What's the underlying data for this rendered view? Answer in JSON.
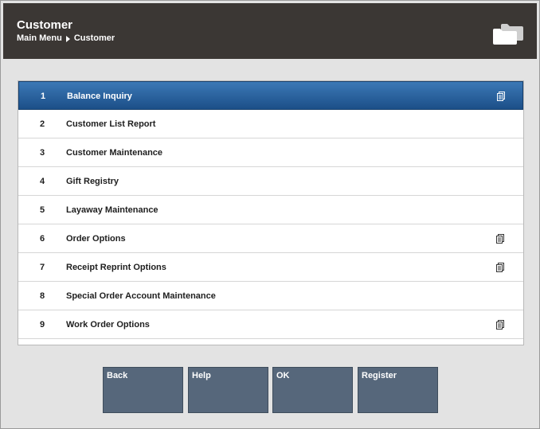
{
  "header": {
    "title": "Customer",
    "breadcrumb": [
      "Main Menu",
      "Customer"
    ],
    "icon": "folder-stack-icon"
  },
  "menu": {
    "items": [
      {
        "number": "1",
        "label": "Balance Inquiry",
        "has_submenu_icon": true,
        "selected": true
      },
      {
        "number": "2",
        "label": "Customer List Report",
        "has_submenu_icon": false
      },
      {
        "number": "3",
        "label": "Customer Maintenance",
        "has_submenu_icon": false
      },
      {
        "number": "4",
        "label": "Gift Registry",
        "has_submenu_icon": false
      },
      {
        "number": "5",
        "label": "Layaway Maintenance",
        "has_submenu_icon": false
      },
      {
        "number": "6",
        "label": "Order Options",
        "has_submenu_icon": true
      },
      {
        "number": "7",
        "label": "Receipt Reprint Options",
        "has_submenu_icon": true
      },
      {
        "number": "8",
        "label": "Special Order Account Maintenance",
        "has_submenu_icon": false
      },
      {
        "number": "9",
        "label": "Work Order Options",
        "has_submenu_icon": true
      }
    ]
  },
  "buttons": {
    "back": "Back",
    "help": "Help",
    "ok": "OK",
    "register": "Register"
  },
  "colors": {
    "header_bg": "#3b3734",
    "selected_bg": "#1f5a97",
    "button_bg": "#56677b"
  }
}
